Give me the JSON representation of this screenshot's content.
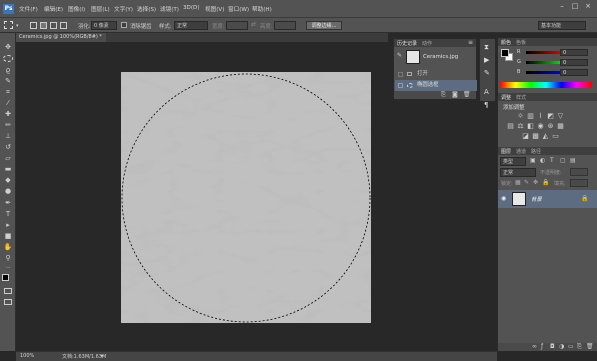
{
  "app": {
    "logo": "Ps"
  },
  "menu": [
    "文件(F)",
    "编辑(E)",
    "图像(I)",
    "图层(L)",
    "文字(Y)",
    "选择(S)",
    "滤镜(T)",
    "3D(D)",
    "视图(V)",
    "窗口(W)",
    "帮助(H)"
  ],
  "window_controls": [
    "–",
    "□",
    "×"
  ],
  "options": {
    "feather_label": "羽化:",
    "feather_value": "0 像素",
    "antialias_label": "消除锯齿",
    "style_label": "样式:",
    "style_value": "正常",
    "width_label": "宽度:",
    "height_label": "高度:",
    "refine_button": "调整边缘...",
    "workspace": "基本功能"
  },
  "document_tab": "Ceramics.jpg @ 100%(RGB/8#) *",
  "status": {
    "zoom": "100%",
    "doc_info": "文档:1.63M/1.63M"
  },
  "history_panel": {
    "tabs": [
      "历史记录",
      "动作"
    ],
    "snapshot": "Ceramics.jpg",
    "items": [
      "打开",
      "椭圆选框"
    ]
  },
  "color_panel": {
    "tabs": [
      "颜色",
      "色板"
    ],
    "channels": [
      {
        "label": "R",
        "value": "0"
      },
      {
        "label": "G",
        "value": "0"
      },
      {
        "label": "B",
        "value": "0"
      }
    ]
  },
  "adjust_panel": {
    "tabs": [
      "调整",
      "样式"
    ],
    "title": "添加调整"
  },
  "layers_panel": {
    "tabs": [
      "图层",
      "通道",
      "路径"
    ],
    "kind_filter": "类型",
    "blend_mode": "正常",
    "opacity_label": "不透明度:",
    "lock_label": "锁定:",
    "fill_label": "填充:",
    "layer_name": "背景"
  },
  "colors": {
    "accent": "#3d74b6",
    "selection_row": "#5d6c80",
    "panel_bg": "#535353",
    "canvas_bg": "#282828"
  }
}
